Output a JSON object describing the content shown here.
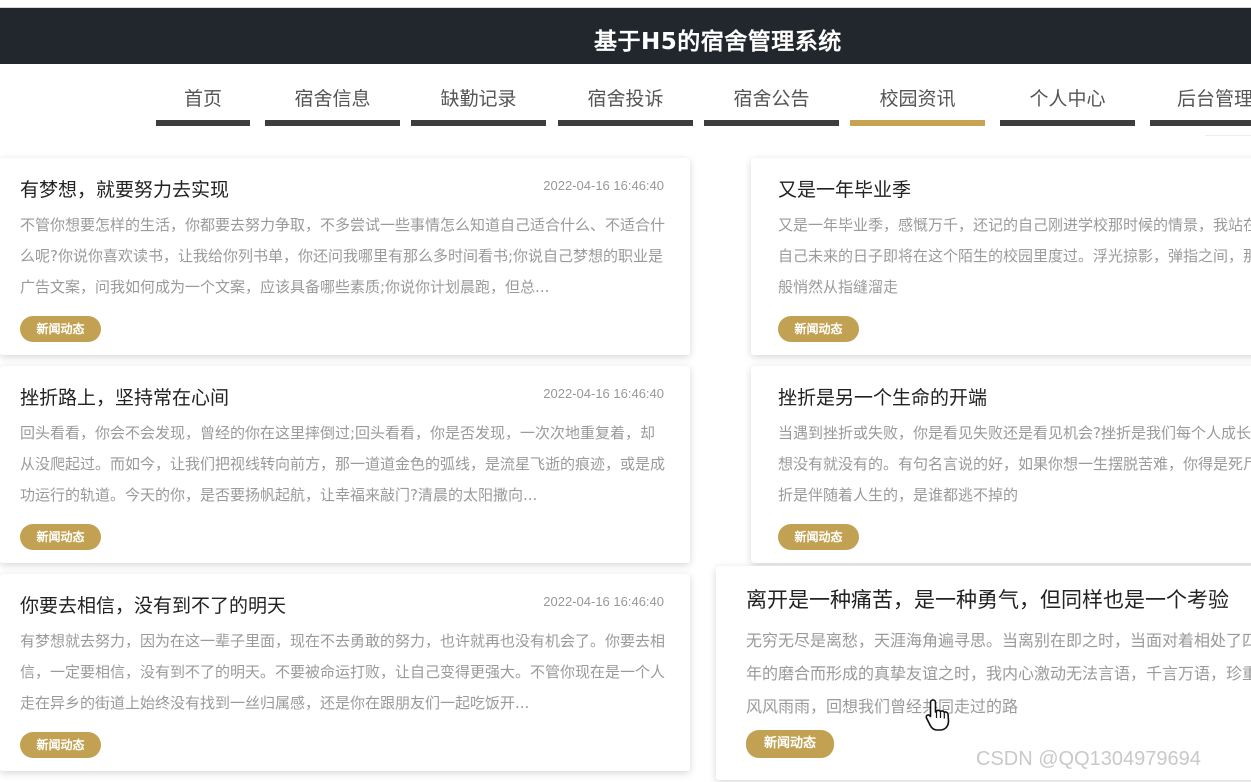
{
  "header": {
    "title": "基于H5的宿舍管理系统"
  },
  "nav": {
    "items": [
      {
        "label": "首页",
        "active": false
      },
      {
        "label": "宿舍信息",
        "active": false
      },
      {
        "label": "缺勤记录",
        "active": false
      },
      {
        "label": "宿舍投诉",
        "active": false
      },
      {
        "label": "宿舍公告",
        "active": false
      },
      {
        "label": "校园资讯",
        "active": true
      },
      {
        "label": "个人中心",
        "active": false
      },
      {
        "label": "后台管理",
        "active": false
      }
    ]
  },
  "news": [
    {
      "title": "有梦想，就要努力去实现",
      "date": "2022-04-16 16:46:40",
      "summary": "不管你想要怎样的生活，你都要去努力争取，不多尝试一些事情怎么知道自己适合什么、不适合什么呢?你说你喜欢读书，让我给你列书单，你还问我哪里有那么多时间看书;你说自己梦想的职业是广告文案，问我如何成为一个文案，应该具备哪些素质;你说你计划晨跑，但总...",
      "tag": "新闻动态"
    },
    {
      "title": "又是一年毕业季",
      "date": "",
      "summary": "又是一年毕业季，感慨万千，还记的自己刚进学校那时候的情景，我站在偌大的教学楼前面，感叹自己未来的日子即将在这个陌生的校园里度过。浮光掠影，弹指之间，那些青葱岁月如同白驹过隙般悄然从指缝溜走",
      "tag": "新闻动态"
    },
    {
      "title": "挫折路上，坚持常在心间",
      "date": "2022-04-16 16:46:40",
      "summary": "回头看看，你会不会发现，曾经的你在这里摔倒过;回头看看，你是否发现，一次次地重复着，却从没爬起过。而如今，让我们把视线转向前方，那一道道金色的弧线，是流星飞逝的痕迹，或是成功运行的轨道。今天的你，是否要扬帆起航，让幸福来敲门?清晨的太阳撒向...",
      "tag": "新闻动态"
    },
    {
      "title": "挫折是另一个生命的开端",
      "date": "",
      "summary": "当遇到挫折或失败，你是看见失败还是看见机会?挫折是我们每个人成长的必修课，你想有就有，想没有就没有的。有句名言说的好，如果你想一生摆脱苦难，你得是死尸。这句话形象地说明了挫折是伴随着人生的，是谁都逃不掉的",
      "tag": "新闻动态"
    },
    {
      "title": "你要去相信，没有到不了的明天",
      "date": "2022-04-16 16:46:40",
      "summary": "有梦想就去努力，因为在这一辈子里面，现在不去勇敢的努力，也许就再也没有机会了。你要去相信，一定要相信，没有到不了的明天。不要被命运打败，让自己变得更强大。不管你现在是一个人走在异乡的街道上始终没有找到一丝归属感，还是你在跟朋友们一起吃饭开...",
      "tag": "新闻动态"
    },
    {
      "title": "离开是一种痛苦，是一种勇气，但同样也是一个考验",
      "date": "",
      "summary": "无穷无尽是离愁，天涯海角遍寻思。当离别在即之时，当面对着相处了四年的好友，当面对着经历了四年的磨合而形成的真挚友谊之时，我内心激动无法言语，千言万语，珍重都很难出口。回想四年大学的风风雨雨，回想我们曾经共同走过的路",
      "tag": "新闻动态"
    }
  ],
  "watermark": "CSDN @QQ1304979694",
  "colors": {
    "header_bg": "#22272e",
    "accent": "#c7a451",
    "nav_bar": "#3d3d3d"
  },
  "icons": {
    "cursor": "hand-pointer-icon"
  }
}
